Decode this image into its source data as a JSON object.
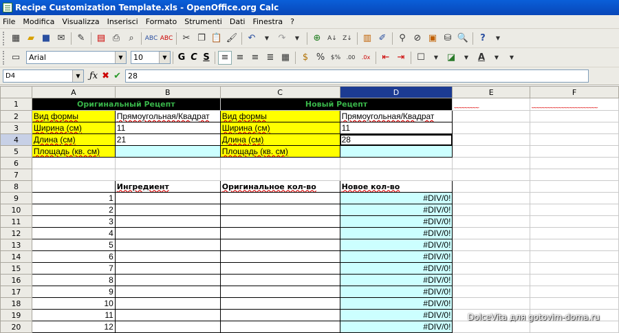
{
  "window": {
    "title": "Recipe Customization Template.xls - OpenOffice.org Calc"
  },
  "menu": [
    "File",
    "Modifica",
    "Visualizza",
    "Inserisci",
    "Formato",
    "Strumenti",
    "Dati",
    "Finestra",
    "?"
  ],
  "toolbar2": {
    "font_name": "Arial",
    "font_size": "10",
    "bold": "G",
    "italic": "C",
    "underline": "S"
  },
  "formula_bar": {
    "cell_ref": "D4",
    "value": "28"
  },
  "columns": [
    "A",
    "B",
    "C",
    "D",
    "E",
    "F"
  ],
  "rows": [
    "1",
    "2",
    "3",
    "4",
    "5",
    "6",
    "7",
    "8",
    "9",
    "10",
    "11",
    "12",
    "13",
    "14",
    "15",
    "16",
    "17",
    "18",
    "19",
    "20"
  ],
  "sheet": {
    "orig_header": "Оригинальный Рецепт",
    "new_header": "Новый Рецепт",
    "labels": {
      "shape": "Вид формы",
      "width": "Ширина (см)",
      "length": "Длина (см)",
      "area": "Площадь (кв. см)"
    },
    "orig_shape": "Прямоугольная/Квадрат",
    "orig_width": "11",
    "orig_length": "21",
    "new_shape": "Прямоугольная/Квадрат",
    "new_width": "11",
    "new_length": "28",
    "col_ingredient": "Ингредиент",
    "col_orig_qty": "Оригинальное кол-во",
    "col_new_qty": "Новое кол-во",
    "items": [
      {
        "n": "1",
        "v": "#DIV/0!"
      },
      {
        "n": "2",
        "v": "#DIV/0!"
      },
      {
        "n": "3",
        "v": "#DIV/0!"
      },
      {
        "n": "4",
        "v": "#DIV/0!"
      },
      {
        "n": "5",
        "v": "#DIV/0!"
      },
      {
        "n": "6",
        "v": "#DIV/0!"
      },
      {
        "n": "7",
        "v": "#DIV/0!"
      },
      {
        "n": "8",
        "v": "#DIV/0!"
      },
      {
        "n": "9",
        "v": "#DIV/0!"
      },
      {
        "n": "10",
        "v": "#DIV/0!"
      },
      {
        "n": "11",
        "v": "#DIV/0!"
      },
      {
        "n": "12",
        "v": "#DIV/0!"
      }
    ]
  },
  "watermark": "DolceVita для gotovim-doma.ru"
}
